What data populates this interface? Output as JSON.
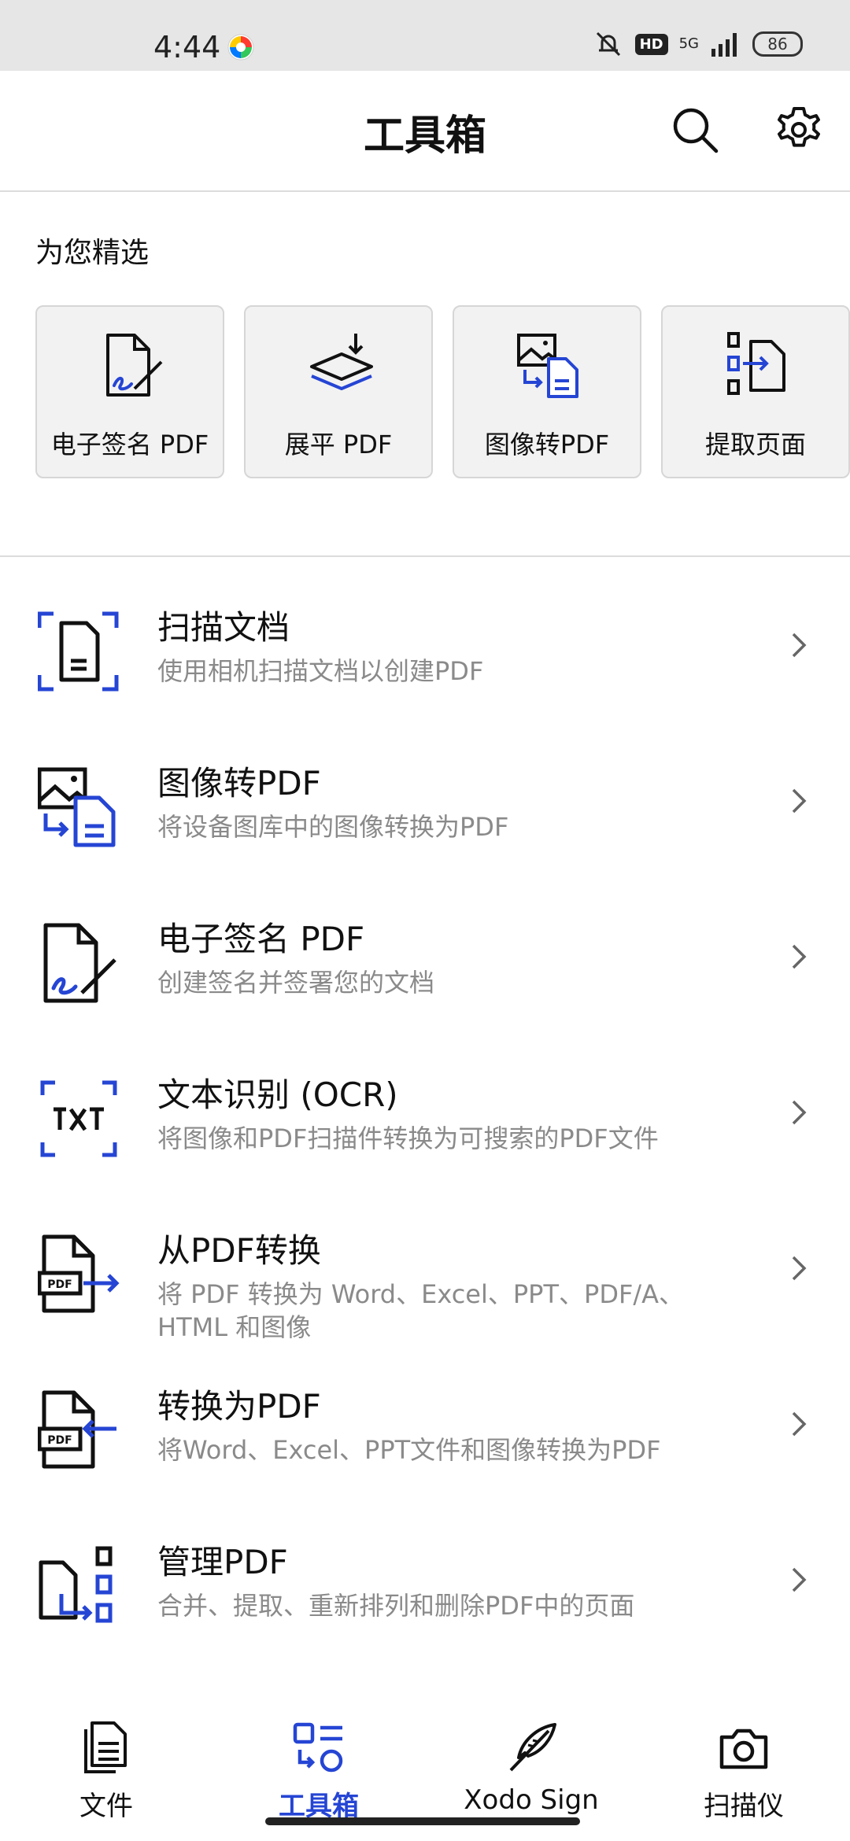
{
  "status_bar": {
    "time": "4:44",
    "network": "5G",
    "hd": "HD",
    "battery": "86"
  },
  "header": {
    "title": "工具箱"
  },
  "featured": {
    "title": "为您精选",
    "cards": [
      {
        "label": "电子签名 PDF",
        "icon": "esign-icon"
      },
      {
        "label": "展平 PDF",
        "icon": "flatten-icon"
      },
      {
        "label": "图像转PDF",
        "icon": "image-to-pdf-icon"
      },
      {
        "label": "提取页面",
        "icon": "extract-pages-icon"
      }
    ]
  },
  "tools": [
    {
      "title": "扫描文档",
      "desc": "使用相机扫描文档以创建PDF",
      "icon": "scan-doc-icon"
    },
    {
      "title": "图像转PDF",
      "desc": "将设备图库中的图像转换为PDF",
      "icon": "image-to-pdf-icon"
    },
    {
      "title": "电子签名 PDF",
      "desc": "创建签名并签署您的文档",
      "icon": "esign-icon"
    },
    {
      "title": "文本识别 (OCR)",
      "desc": "将图像和PDF扫描件转换为可搜索的PDF文件",
      "icon": "ocr-icon"
    },
    {
      "title": "从PDF转换",
      "desc": "将 PDF 转换为 Word、Excel、PPT、PDF/A、HTML 和图像",
      "icon": "convert-from-pdf-icon"
    },
    {
      "title": "转换为PDF",
      "desc": "将Word、Excel、PPT文件和图像转换为PDF",
      "icon": "convert-to-pdf-icon"
    },
    {
      "title": "管理PDF",
      "desc": "合并、提取、重新排列和删除PDF中的页面",
      "icon": "manage-pdf-icon"
    }
  ],
  "bottom_nav": [
    {
      "label": "文件",
      "icon": "files-icon",
      "active": false
    },
    {
      "label": "工具箱",
      "icon": "toolbox-icon",
      "active": true
    },
    {
      "label": "Xodo Sign",
      "icon": "quill-icon",
      "active": false
    },
    {
      "label": "扫描仪",
      "icon": "camera-icon",
      "active": false
    }
  ],
  "colors": {
    "accent": "#2545d4",
    "text": "#111111",
    "secondary": "#8a8a8a"
  }
}
